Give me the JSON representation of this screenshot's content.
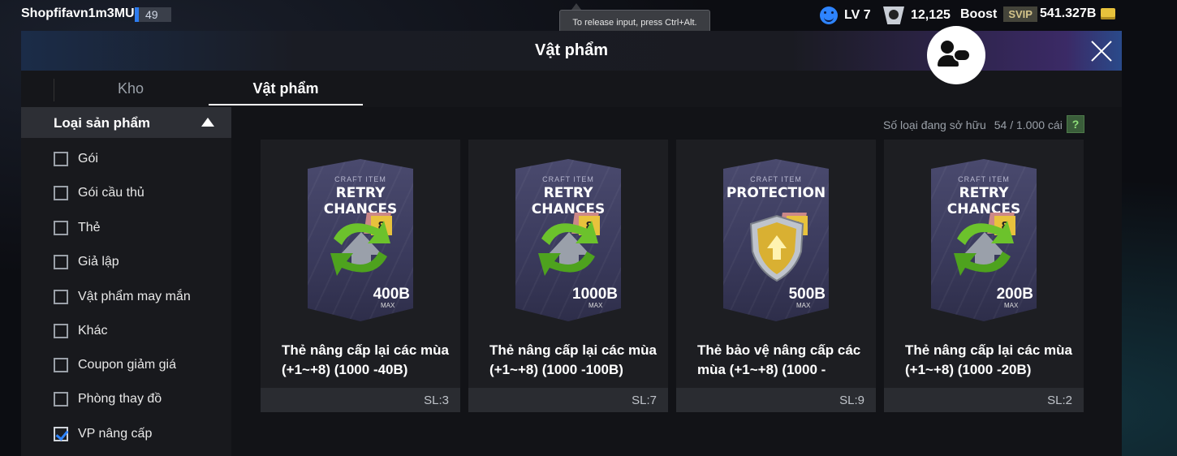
{
  "topbar": {
    "username": "Shopfifavn1m3MU",
    "user_level": "49",
    "tooltip": "To release input, press Ctrl+Alt.",
    "level": "LV 7",
    "points": "12,125",
    "boost_label": "Boost",
    "svip_label": "SVIP",
    "currency": "541.327B"
  },
  "window": {
    "title": "Vật phẩm",
    "tabs": [
      {
        "label": "Kho"
      },
      {
        "label": "Vật phẩm"
      }
    ]
  },
  "sidebar": {
    "heading": "Loại sản phẩm",
    "filters": [
      {
        "label": "Gói",
        "checked": false
      },
      {
        "label": "Gói cầu thủ",
        "checked": false
      },
      {
        "label": "Thẻ",
        "checked": false
      },
      {
        "label": "Giả lập",
        "checked": false
      },
      {
        "label": "Vật phẩm may mắn",
        "checked": false
      },
      {
        "label": "Khác",
        "checked": false
      },
      {
        "label": "Coupon giảm giá",
        "checked": false
      },
      {
        "label": "Phòng thay đồ",
        "checked": false
      },
      {
        "label": "VP nâng cấp",
        "checked": true
      }
    ]
  },
  "inventory": {
    "owned_label": "Số loại đang sở hữu",
    "owned_count": "54 / 1.000 cái",
    "help_label": "?"
  },
  "items": [
    {
      "subtitle": "CRAFT ITEM",
      "pack_title": "RETRY CHANCES",
      "badge": "8",
      "price": "400B",
      "max_label": "MAX",
      "name": "Thẻ nâng cấp lại các mùa (+1~+8) (1000 -40B)",
      "qty": "SL:3",
      "icon": "retry-arrows-icon"
    },
    {
      "subtitle": "CRAFT ITEM",
      "pack_title": "RETRY CHANCES",
      "badge": "8",
      "price": "1000B",
      "max_label": "MAX",
      "name": "Thẻ nâng cấp lại các mùa (+1~+8) (1000 -100B)",
      "qty": "SL:7",
      "icon": "retry-arrows-icon"
    },
    {
      "subtitle": "CRAFT ITEM",
      "pack_title": "PROTECTION",
      "badge": "8",
      "price": "500B",
      "max_label": "MAX",
      "name": "Thẻ bảo vệ nâng cấp các mùa (+1~+8) (1000 -",
      "qty": "SL:9",
      "icon": "shield-icon"
    },
    {
      "subtitle": "CRAFT ITEM",
      "pack_title": "RETRY CHANCES",
      "badge": "8",
      "price": "200B",
      "max_label": "MAX",
      "name": "Thẻ nâng cấp lại các mùa (+1~+8) (1000 -20B)",
      "qty": "SL:2",
      "icon": "retry-arrows-icon"
    }
  ],
  "colors": {
    "accent": "#2e84ff",
    "panel": "#1d1e22",
    "sidebar_head": "#2d2f35",
    "gold": "#e8c23c"
  }
}
